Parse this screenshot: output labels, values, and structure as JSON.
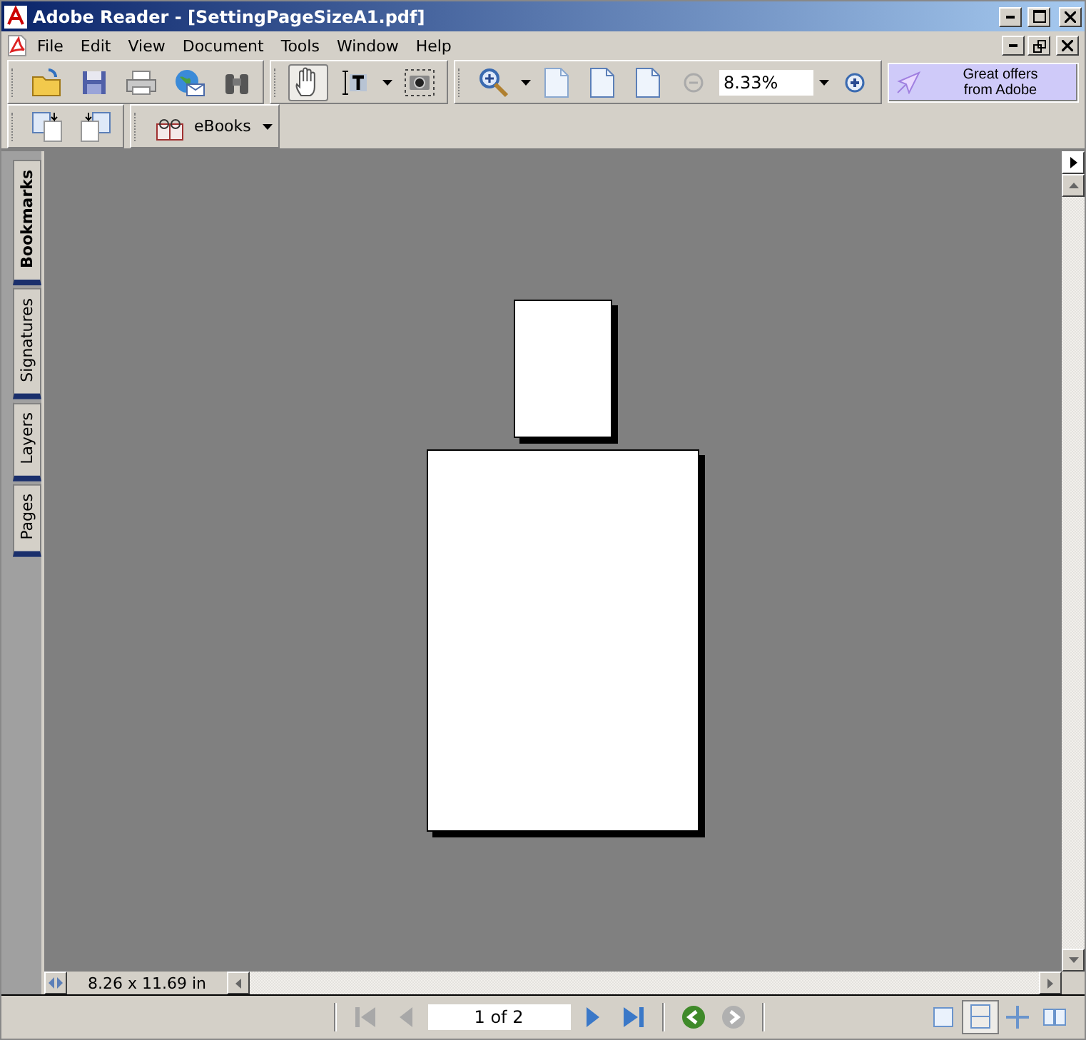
{
  "window": {
    "title": "Adobe Reader - [SettingPageSizeA1.pdf]"
  },
  "menu": [
    "File",
    "Edit",
    "View",
    "Document",
    "Tools",
    "Window",
    "Help"
  ],
  "tools": [
    {
      "kind": "hand",
      "selected": true
    },
    {
      "kind": "text",
      "selected": false
    },
    {
      "kind": "snapshot",
      "selected": false
    }
  ],
  "zoom": {
    "value": "8.33%"
  },
  "ad": {
    "lines": [
      "Great offers",
      "from Adobe"
    ]
  },
  "ebooks": {
    "label": "eBooks"
  },
  "side_tabs": [
    {
      "label": "Bookmarks",
      "selected": true
    },
    {
      "label": "Signatures",
      "selected": false
    },
    {
      "label": "Layers",
      "selected": false
    },
    {
      "label": "Pages",
      "selected": false
    }
  ],
  "page_size": "8.26 x 11.69 in",
  "navigation": [
    {
      "kind": "first",
      "disabled": true
    },
    {
      "kind": "prev",
      "disabled": true
    },
    {
      "kind": "page_field",
      "value": "1 of 2"
    },
    {
      "kind": "next",
      "disabled": false
    },
    {
      "kind": "last",
      "disabled": false
    },
    {
      "kind": "back",
      "disabled": false
    },
    {
      "kind": "forward",
      "disabled": true
    }
  ],
  "layouts": [
    {
      "kind": "single",
      "selected": false
    },
    {
      "kind": "continuous",
      "selected": true
    },
    {
      "kind": "continuous_facing",
      "selected": false
    },
    {
      "kind": "facing",
      "selected": false
    }
  ]
}
